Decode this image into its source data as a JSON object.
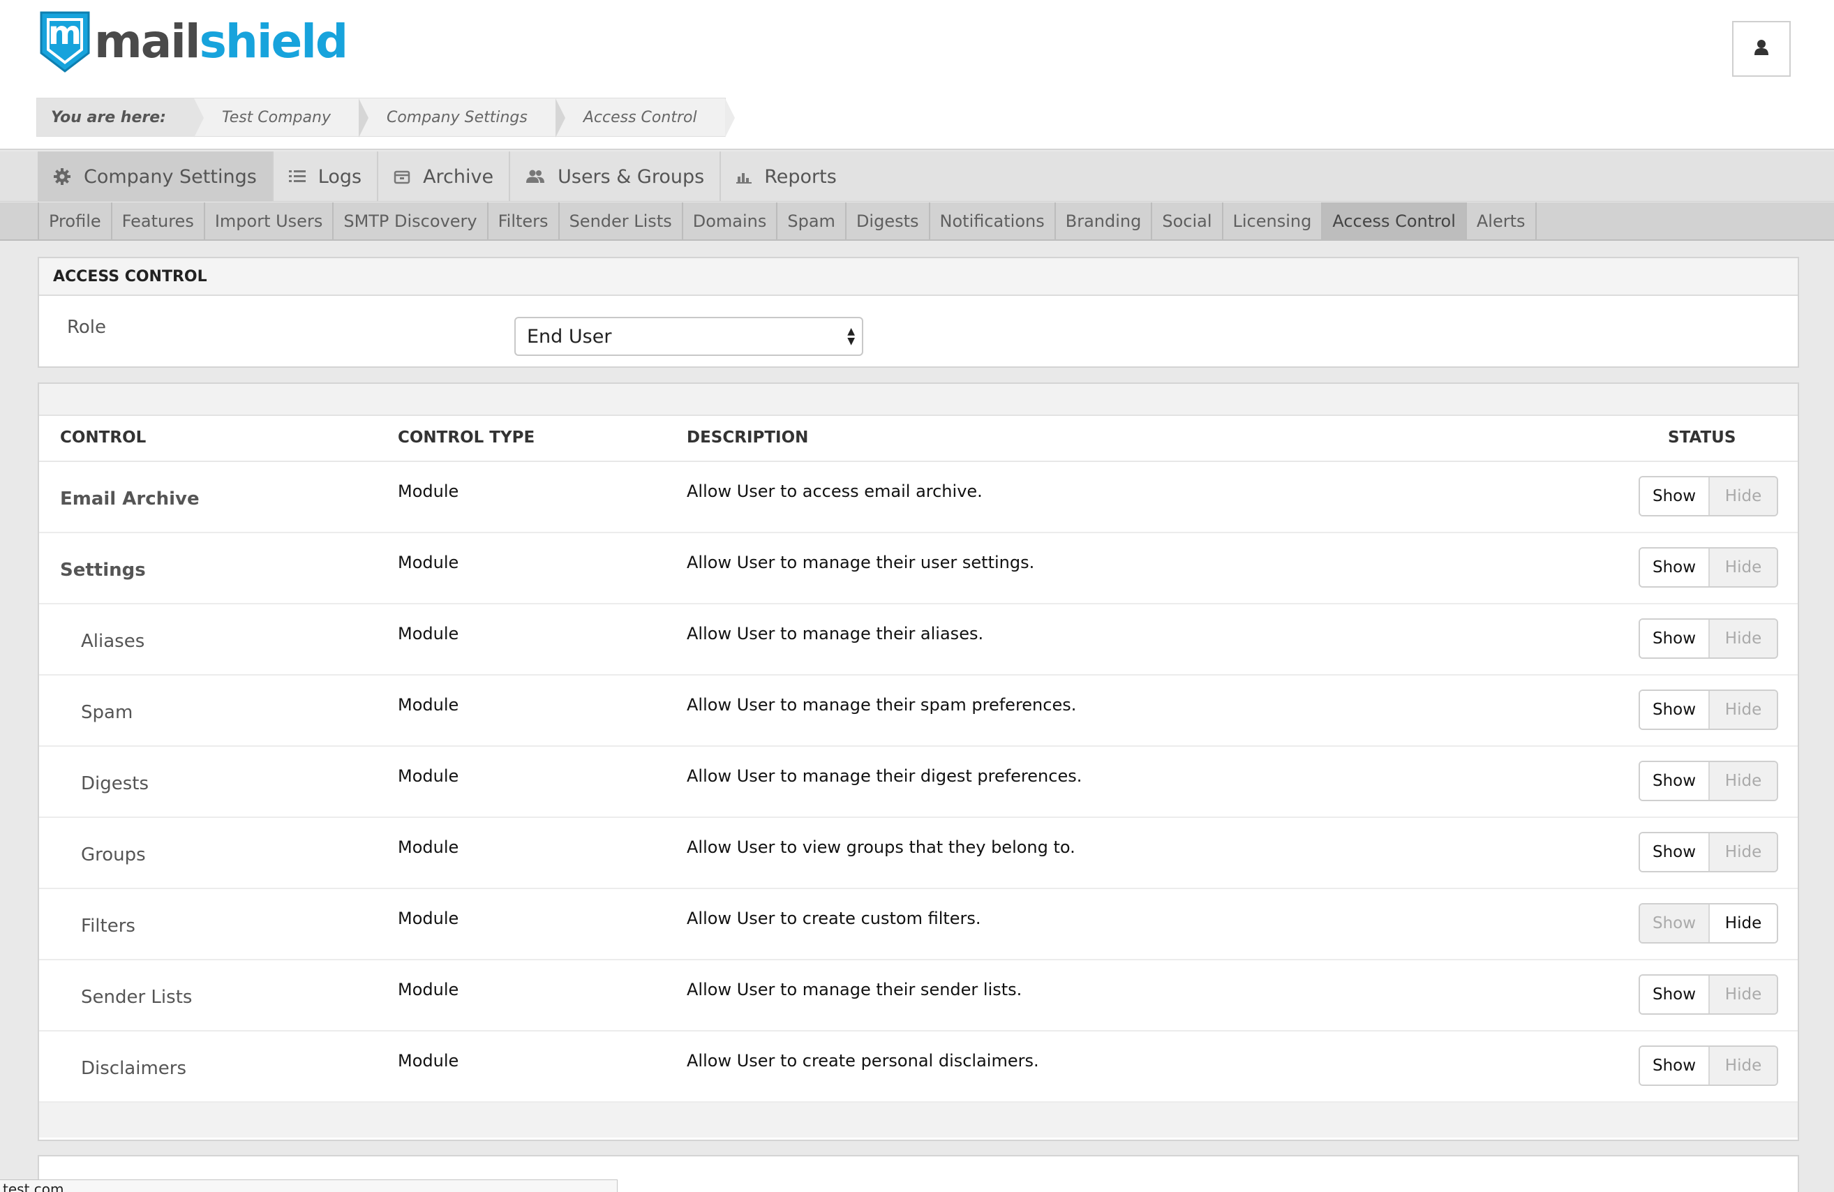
{
  "brand": {
    "logo_letter": "m",
    "name_part1": "mail",
    "name_part2": "shield",
    "accent_color": "#17a3dc"
  },
  "header": {
    "user_icon": "user-icon"
  },
  "breadcrumb": {
    "lead": "You are here:",
    "items": [
      "Test Company",
      "Company Settings",
      "Access Control"
    ]
  },
  "main_nav": [
    {
      "label": "Company Settings",
      "icon": "gear-icon",
      "active": true
    },
    {
      "label": "Logs",
      "icon": "list-icon",
      "active": false
    },
    {
      "label": "Archive",
      "icon": "archive-icon",
      "active": false
    },
    {
      "label": "Users & Groups",
      "icon": "users-icon",
      "active": false
    },
    {
      "label": "Reports",
      "icon": "bar-chart-icon",
      "active": false
    }
  ],
  "sub_nav": [
    "Profile",
    "Features",
    "Import Users",
    "SMTP Discovery",
    "Filters",
    "Sender Lists",
    "Domains",
    "Spam",
    "Digests",
    "Notifications",
    "Branding",
    "Social",
    "Licensing",
    "Access Control",
    "Alerts"
  ],
  "sub_nav_active": "Access Control",
  "access_control": {
    "title": "ACCESS CONTROL",
    "role_label": "Role",
    "role_value": "End User"
  },
  "table": {
    "headers": {
      "control": "CONTROL",
      "control_type": "CONTROL TYPE",
      "description": "DESCRIPTION",
      "status": "STATUS"
    },
    "show_label": "Show",
    "hide_label": "Hide",
    "rows": [
      {
        "control": "Email Archive",
        "type": "Module",
        "description": "Allow User to access email archive.",
        "status": "Show"
      },
      {
        "control": "Settings",
        "type": "Module",
        "description": "Allow User to manage their user settings.",
        "status": "Show"
      },
      {
        "control": "Aliases",
        "type": "Module",
        "description": "Allow User to manage their aliases.",
        "status": "Show"
      },
      {
        "control": "Spam",
        "type": "Module",
        "description": "Allow User to manage their spam preferences.",
        "status": "Show"
      },
      {
        "control": "Digests",
        "type": "Module",
        "description": "Allow User to manage their digest preferences.",
        "status": "Show"
      },
      {
        "control": "Groups",
        "type": "Module",
        "description": "Allow User to view groups that they belong to.",
        "status": "Show"
      },
      {
        "control": "Filters",
        "type": "Module",
        "description": "Allow User to create custom filters.",
        "status": "Hide"
      },
      {
        "control": "Sender Lists",
        "type": "Module",
        "description": "Allow User to manage their sender lists.",
        "status": "Show"
      },
      {
        "control": "Disclaimers",
        "type": "Module",
        "description": "Allow User to create personal disclaimers.",
        "status": "Show"
      }
    ]
  },
  "status_bar": "test.com"
}
